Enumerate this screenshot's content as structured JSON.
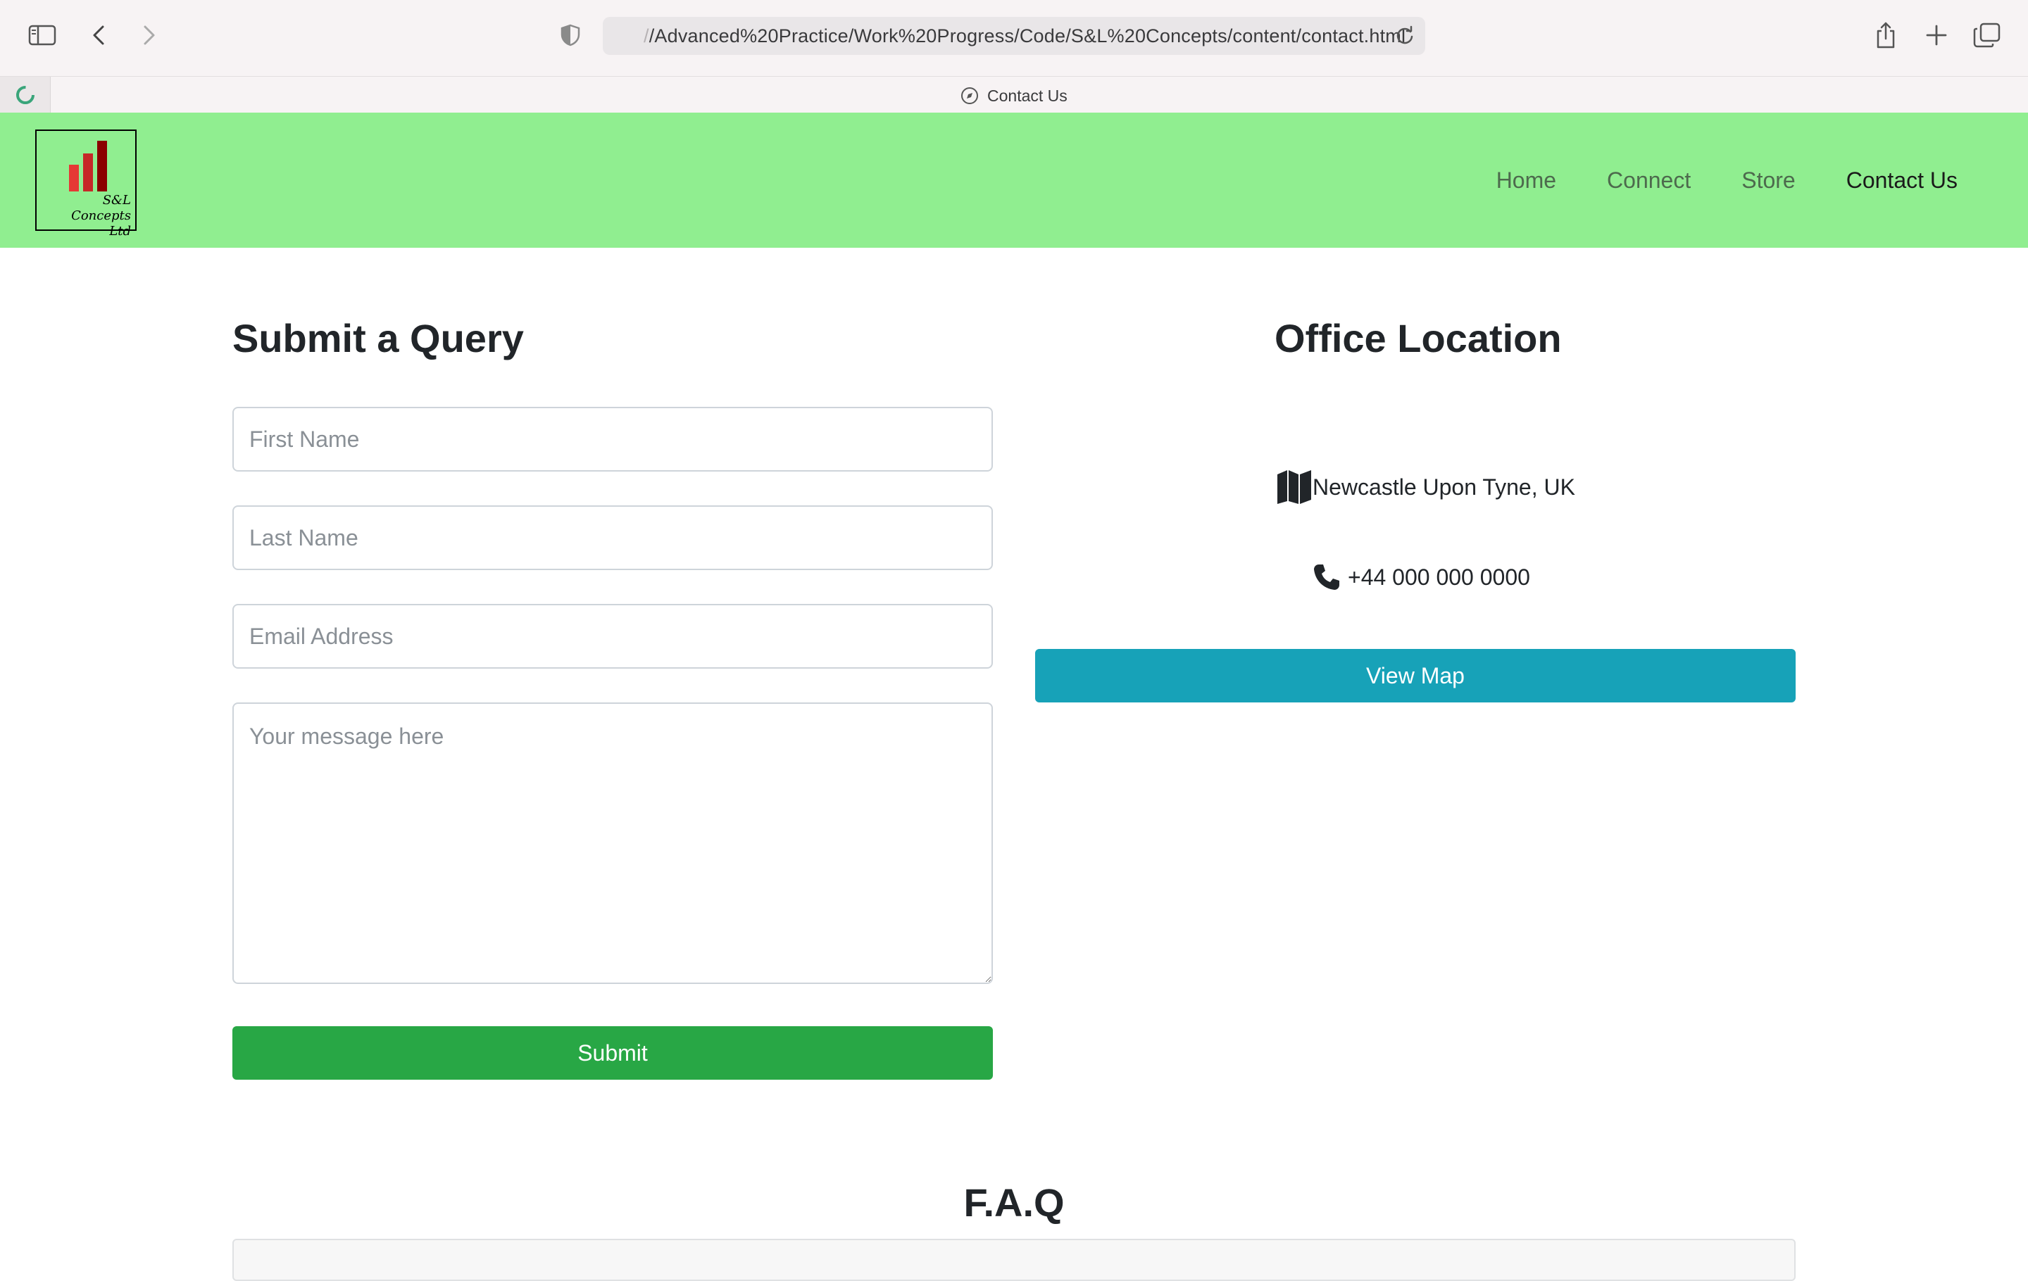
{
  "browser": {
    "url_prefix": "/",
    "url_main": "/Advanced%20Practice/Work%20Progress/Code/S&L%20Concepts/content/contact.html",
    "tab_title": "Contact Us"
  },
  "site": {
    "logo_text_line1": "S&L Concepts",
    "logo_text_line2": "Ltd",
    "nav": [
      {
        "label": "Home"
      },
      {
        "label": "Connect"
      },
      {
        "label": "Store"
      },
      {
        "label": "Contact Us"
      }
    ],
    "colors": {
      "header_bg": "#90ee90",
      "submit_button": "#28a745",
      "map_button": "#17a2b8"
    }
  },
  "form": {
    "title": "Submit a Query",
    "first_name_placeholder": "First Name",
    "last_name_placeholder": "Last Name",
    "email_placeholder": "Email Address",
    "message_placeholder": "Your message here",
    "submit_label": "Submit"
  },
  "office": {
    "title": "Office Location",
    "location": "Newcastle Upon Tyne, UK",
    "location_icon": "map-icon",
    "phone": "+44 000 000 0000",
    "phone_icon": "phone-icon",
    "view_map_label": "View Map"
  },
  "faq": {
    "title": "F.A.Q"
  }
}
